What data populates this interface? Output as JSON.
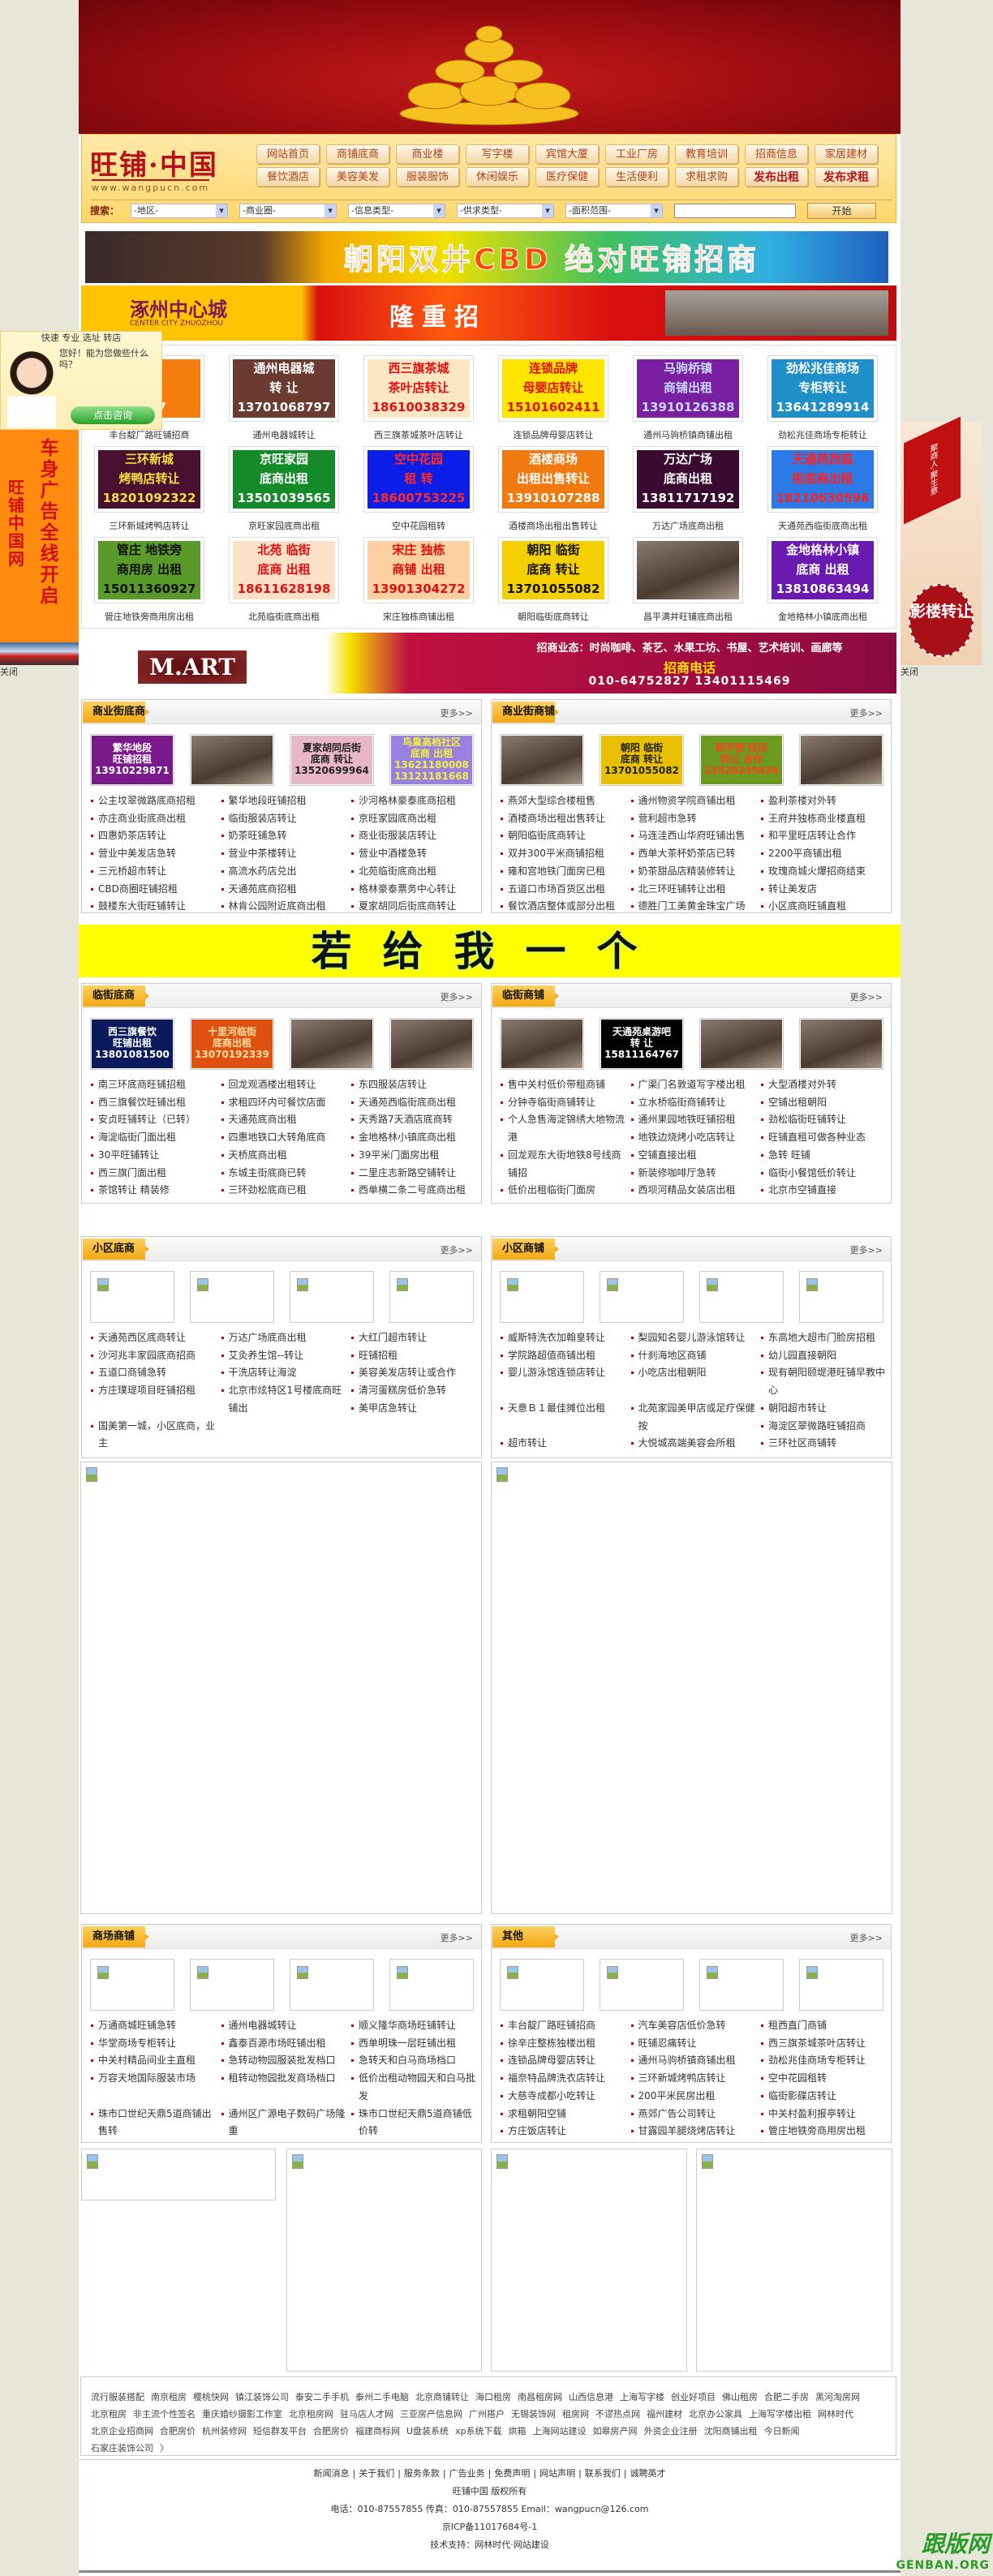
{
  "header": {
    "logo": "旺铺·中国",
    "logo_url": "www.wangpucn.com",
    "nav": [
      "网站首页",
      "商铺底商",
      "商业楼",
      "写字楼",
      "宾馆大厦",
      "工业厂房",
      "教育培训",
      "招商信息",
      "家居建材",
      "餐饮酒店",
      "美容美发",
      "服装服饰",
      "休闲娱乐",
      "医疗保健",
      "生活便利",
      "求租求购",
      "发布出租",
      "发布求租"
    ],
    "search": {
      "label": "搜索：",
      "selects": [
        "-地区-",
        "-商业圈-",
        "-信息类型-",
        "-供求类型-",
        "-面积范围-"
      ],
      "input_value": "",
      "button": "开始"
    }
  },
  "banners": {
    "cbd": "朝阳双井CBD 绝对旺铺招商",
    "zhuozhou_logo": "涿州中心城",
    "zhuozhou_sub": "CENTER CITY ZHUOZHOU",
    "zhuozhou_text": "隆重招",
    "mart_logo": "M.ART",
    "mart_line1": "招商业态：时尚咖啡、茶艺、水果工坊、书屋、艺术培训、画廊等",
    "mart_line2": "招商电话",
    "mart_line3": "010-64752827  13401115469",
    "yellow": "若给我一个"
  },
  "ad_tiles": [
    {
      "lines": [
        "厂路",
        "商",
        "7827"
      ],
      "caption": "丰台靛厂路旺铺招商",
      "bg": "#f57d10",
      "fg": "#ffffff"
    },
    {
      "lines": [
        "通州电器城",
        "转  让",
        "13701068797"
      ],
      "caption": "通州电器城转让",
      "bg": "#6b3a30",
      "fg": "#ffffff"
    },
    {
      "lines": [
        "西三旗茶城",
        "茶叶店转让",
        "18610038329"
      ],
      "caption": "西三旗茶城茶叶店转让",
      "bg": "#fde6c4",
      "fg": "#e01010"
    },
    {
      "lines": [
        "连锁品牌",
        "母婴店转让",
        "15101602411"
      ],
      "caption": "连锁品牌母婴店转让",
      "bg": "#ffe600",
      "fg": "#e01010"
    },
    {
      "lines": [
        "马驹桥镇",
        "商铺出租",
        "13910126388"
      ],
      "caption": "通州马驹桥镇商铺出租",
      "bg": "#7a1fa0",
      "fg": "#c8d8ff"
    },
    {
      "lines": [
        "劲松兆佳商场",
        "专柜转让",
        "13641289914"
      ],
      "caption": "劲松兆佳商场专柜转让",
      "bg": "#1e8fc8",
      "fg": "#ffffff"
    },
    {
      "lines": [
        "三环新城",
        "烤鸭店转让",
        "18201092322"
      ],
      "caption": "三环新城烤鸭店转让",
      "bg": "#4a1030",
      "fg": "#f0e040"
    },
    {
      "lines": [
        "京旺家园",
        "底商出租",
        "13501039565"
      ],
      "caption": "京旺家园底商出租",
      "bg": "#148a28",
      "fg": "#ffffff"
    },
    {
      "lines": [
        "空中花园",
        "租  转",
        "18600753225"
      ],
      "caption": "空中花园租转",
      "bg": "#0a1ee8",
      "fg": "#ff2a2a"
    },
    {
      "lines": [
        "酒楼商场",
        "出租出售转让",
        "13910107288"
      ],
      "caption": "酒楼商场出租出售转让",
      "bg": "#f07a10",
      "fg": "#ffffff"
    },
    {
      "lines": [
        "万达广场",
        "底商出租",
        "13811717192"
      ],
      "caption": "万达广场底商出租",
      "bg": "#3a0a30",
      "fg": "#ffffff"
    },
    {
      "lines": [
        "天通苑西临",
        "街底商出租",
        "18210630596"
      ],
      "caption": "天通苑西临街底商出租",
      "bg": "#2a7ae8",
      "fg": "#ff2020"
    },
    {
      "lines": [
        "管庄 地铁旁",
        "商用房 出租",
        "15011360927"
      ],
      "caption": "管庄地铁旁商用房出租",
      "bg": "#5a9a2a",
      "fg": "#111111"
    },
    {
      "lines": [
        "北苑 临街",
        "底商 出租",
        "18611628198"
      ],
      "caption": "北苑临街底商出租",
      "bg": "#fde0c8",
      "fg": "#e01010"
    },
    {
      "lines": [
        "宋庄 独栋",
        "商铺 出租",
        "13901304272"
      ],
      "caption": "宋庄独栋商铺出租",
      "bg": "#fcd0a0",
      "fg": "#e01010"
    },
    {
      "lines": [
        "朝阳 临街",
        "底商 转让",
        "13701055082"
      ],
      "caption": "朝阳临街底商转让",
      "bg": "#f5d000",
      "fg": "#111111"
    },
    {
      "lines": [],
      "caption": "昌平满井旺铺底商出租",
      "bg": "photo",
      "fg": "#ffffff"
    },
    {
      "lines": [
        "金地格林小镇",
        "底商 出租",
        "13810863494"
      ],
      "caption": "金地格林小镇底商出租",
      "bg": "#6a1ab0",
      "fg": "#ffffff"
    }
  ],
  "sections": [
    {
      "title": "商业街底商",
      "more": "更多>>",
      "images": [
        {
          "lines": [
            "繁华地段",
            "旺铺招租",
            "13910229871"
          ],
          "bg": "#7a1a8a",
          "fg": "#ffffff"
        },
        {
          "type": "photo"
        },
        {
          "lines": [
            "夏家胡同后街",
            "底商  转让",
            "13520699964"
          ],
          "bg": "#e8b8c8",
          "fg": "#222222"
        },
        {
          "lines": [
            "鸟巢高档社区",
            "底商 出租",
            "13621180008",
            "13121181668"
          ],
          "bg": "#9a80e0",
          "fg": "#f0f040"
        }
      ],
      "items": [
        "公主坟翠微路底商招租",
        "繁华地段旺铺招租",
        "沙河格林豪泰底商招租",
        "亦庄商业街底商出租",
        "临街服装店转让",
        "京旺家园底商出租",
        "四惠奶茶店转让",
        "奶茶旺铺急转",
        "商业街服装店转让",
        "营业中美发店急转",
        "营业中茶楼转让",
        "营业中酒楼急转",
        "三元桥超市转让",
        "高流水药店兑出",
        "北苑临街底商出租",
        "CBD商圈旺铺招租",
        "天通苑底商招租",
        "格林豪泰票务中心转让",
        "鼓楼东大街旺铺转让",
        "林肯公园附近底商出租",
        "夏家胡同后街底商转让"
      ]
    },
    {
      "title": "商业街商铺",
      "more": "更多>>",
      "images": [
        {
          "type": "photo"
        },
        {
          "lines": [
            "朝阳  临街",
            "底商  转让",
            "13701055082"
          ],
          "bg": "#e8c000",
          "fg": "#222222"
        },
        {
          "lines": [
            "和平里  旺店",
            "转让  合作",
            "13520235834"
          ],
          "bg": "#6a9a20",
          "fg": "#ff4020"
        },
        {
          "type": "photo"
        }
      ],
      "items": [
        "燕郊大型综合楼租售",
        "通州物资学院商铺出租",
        "盈利茶楼对外转",
        "酒楼商场出租出售转让",
        "营利超市急转",
        "王府井独栋商业楼直租",
        "朝阳临街底商转让",
        "马连洼西山华府旺铺出售",
        "和平里旺店转让合作",
        "双井300平米商铺招租",
        "西单大茶杯奶茶店已转",
        "2200平商铺出租",
        "雍和宫地铁门面房已租",
        "奶茶甜品店精装修转让",
        "玫瑰商城火爆招商结束",
        "五道口市场百货区出租",
        "北三环旺铺转让出租",
        "转让美发店",
        "餐饮酒店整体或部分出租",
        "德胜门工美黄金珠宝广场",
        "小区底商旺铺直租"
      ]
    },
    {
      "title": "临街底商",
      "more": "更多>>",
      "images": [
        {
          "lines": [
            "西三旗餐饮",
            "旺铺出租",
            "13801081500"
          ],
          "bg": "#0a1a5a",
          "fg": "#ffffff"
        },
        {
          "lines": [
            "十里河临街",
            "底商出租",
            "13070192339"
          ],
          "bg": "#e05010",
          "fg": "#ffe0a0"
        },
        {
          "type": "photo"
        },
        {
          "type": "photo"
        }
      ],
      "items": [
        "南三环底商旺铺招租",
        "回龙观酒楼出租转让",
        "东四服装店转让",
        "西三旗餐饮旺铺出租",
        "求租四环内可餐饮店面",
        "天通苑西临街底商出租",
        "安贞旺铺转让（已转）",
        "天通苑底商出租",
        "天秀路7天酒店底商转",
        "海淀临街门面出租",
        "四惠地铁口大转角底商",
        "金地格林小镇底商出租",
        "30平旺铺转让",
        "天桥底商出租",
        "39平米门面房出租",
        "西三旗门面出租",
        "东城主街底商已转",
        "二里庄志新路空铺转让",
        "茶馆转让 精装修",
        "三环劲松底商已租",
        "西单横二条二号底商出租"
      ]
    },
    {
      "title": "临街商铺",
      "more": "更多>>",
      "images": [
        {
          "type": "photo"
        },
        {
          "lines": [
            "天通苑桌游吧",
            "转    让",
            "15811164767"
          ],
          "bg": "#000000",
          "fg": "#ffffff"
        },
        {
          "type": "photo"
        },
        {
          "type": "photo"
        }
      ],
      "items": [
        "售中关村低价带租商铺",
        "广渠门名敦道写字楼出租",
        "大型酒楼对外转",
        "分钟寺临街商铺转让",
        "立水桥临街商铺转让",
        "空铺出租朝阳",
        "个人急售海淀锦绣大地物流港",
        "通州果园地铁旺铺招租",
        "劲松临街旺铺转让",
        "地铁边烧烤小吃店转让",
        "旺铺直租可做各种业态",
        "回龙观东大街地铁8号线商铺招",
        "空铺直接出租",
        "急转 旺铺",
        "新装修咖啡厅急转",
        "临街小餐馆低价转让",
        "低价出租临街门面房",
        "西坝河精品女装店出租",
        "北京市空铺直接"
      ]
    },
    {
      "title": "小区底商",
      "more": "更多>>",
      "images": [
        {
          "type": "broken"
        },
        {
          "type": "broken"
        },
        {
          "type": "broken"
        },
        {
          "type": "broken"
        }
      ],
      "items": [
        "天通苑西区底商转让",
        "万达广场底商出租",
        "大红门超市转让",
        "沙河兆丰家园底商招商",
        "",
        "艾灸养生馆--转让",
        "旺铺招租",
        "五道口商铺急转",
        "干洗店转让海淀",
        "美容美发店转让或合作",
        "方庄璞瑅项目旺铺招租",
        "北京市炫特区1号楼底商旺铺出",
        "清河蛋糕房低价急转",
        "美甲店急转让",
        "国美第一城，小区底商，业主"
      ]
    },
    {
      "title": "小区商铺",
      "more": "更多>>",
      "images": [
        {
          "type": "broken"
        },
        {
          "type": "broken"
        },
        {
          "type": "broken"
        },
        {
          "type": "broken"
        }
      ],
      "items": [
        "威斯特洗衣加翰皇转让",
        "梨园知名婴儿游泳馆转让",
        "东高地大超市门脸房招租",
        "学院路超值商铺出租",
        "什刹海地区商铺",
        "幼儿园直接朝阳",
        "婴儿游泳馆连锁店转让",
        "小吃店出租朝阳",
        "现有朝阳颐堤港旺铺早教中心",
        "天意Ｂ１最佳摊位出租",
        "北苑家园美甲店或足疗保健按",
        "朝阳超市转让",
        "海淀区翠微路旺铺招商",
        "超市转让",
        "大悦城高端美容会所租",
        "三环社区商铺转"
      ]
    },
    {
      "title": "商场商铺",
      "more": "更多>>",
      "images": [
        {
          "type": "broken"
        },
        {
          "type": "broken"
        },
        {
          "type": "broken"
        },
        {
          "type": "broken"
        }
      ],
      "items": [
        "万通商城旺铺急转",
        "通州电器城转让",
        "顺义隆华商场旺铺转让",
        "华堂商场专柜转让",
        "鑫泰百源市场旺铺出租",
        "西单明珠一层旺铺出租",
        "中关村精品间业主直租",
        "急转动物园服装批发档口",
        "急转天和白马商场档口",
        "万容天地国际服装市场",
        "租转动物园批发商场档口",
        "低价出租动物园天和白马批发",
        "珠市口世纪天鼎5道商铺出售转",
        "通州区广源电子数码广场隆重",
        "珠市口世纪天鼎5道商铺低价转"
      ]
    },
    {
      "title": "其他",
      "more": "更多>>",
      "images": [
        {
          "type": "broken"
        },
        {
          "type": "broken"
        },
        {
          "type": "broken"
        },
        {
          "type": "broken"
        }
      ],
      "items": [
        "丰台靛厂路旺铺招商",
        "汽车美容店低价急转",
        "租西直门商铺",
        "徐辛庄整栋独楼出租",
        "旺铺忍痛转让",
        "西三旗茶城茶叶店转让",
        "连锁品牌母婴店转让",
        "通州马驹桥镇商铺出租",
        "劲松兆佳商场专柜转让",
        "福奈特品牌洗衣店转让",
        "三环新城烤鸭店转让",
        "空中花园租转",
        "大慈寺成都小吃转让",
        "200平米民房出租",
        "临街影碟店转让",
        "求租朝阳空铺",
        "燕郊广告公司转让",
        "中关村盈利报亭转让",
        "方庄饭店转让",
        "甘露园羊腿烧烤店转让",
        "管庄地铁旁商用房出租"
      ]
    }
  ],
  "friend_links": [
    "流行服装搭配",
    "南京租房",
    "樱桃快网",
    "镇江装饰公司",
    "泰安二手手机",
    "泰州二手电脑",
    "北京商铺转让",
    "海口租房",
    "南昌租房网",
    "山西信息港",
    "上海写字楼",
    "创业好项目",
    "佛山租房",
    "合肥二手房",
    "黑河淘房网",
    "北京租房",
    "非主流个性签名",
    "重庆婚纱摄影工作室",
    "北京租房网",
    "驻马店人才网",
    "三亚房产信息网",
    "广州搭户",
    "无锡装饰网",
    "租房网",
    "不谬热点网",
    "福州建材",
    "北京办公家具",
    "上海写字楼出租",
    "网林时代",
    "北京企业招商网",
    "合肥房价",
    "杭州装修网",
    "短信群发平台",
    "合肥房价",
    "福建商标网",
    "U盘装系统",
    "xp系统下载",
    "烘箱",
    "上海网站建设",
    "如皋房产网",
    "外资企业注册",
    "沈阳商铺出租",
    "今日新闻",
    "石家庄装饰公司",
    "〉"
  ],
  "footer": {
    "links": [
      "新闻消息",
      "关于我们",
      "服务条款",
      "广告业务",
      "免费声明",
      "网站声明",
      "联系我们",
      "诚聘英才"
    ],
    "separator": "|",
    "copyright": "旺铺中国 版权所有",
    "contact": "电话：010-87557855 传真：010-87557855  Email：wangpucn@126.com",
    "icp": "京ICP备11017684号-1",
    "support": "技术支持：网林时代·网站建设"
  },
  "floaters": {
    "cs_header": "快速 专业 选址 转店",
    "cs_question": "您好！能为您做些什么吗？",
    "cs_button": "点击咨询",
    "left_ad_1": "旺铺中国网",
    "left_ad_2": "车身广告全线开启",
    "left_close": "关闭",
    "right_sign": "聚商人·聚生意",
    "right_circle": "影楼转让",
    "right_close": "关闭"
  },
  "watermark": {
    "cn": "跟版网",
    "en": "GENBAN.ORG"
  }
}
